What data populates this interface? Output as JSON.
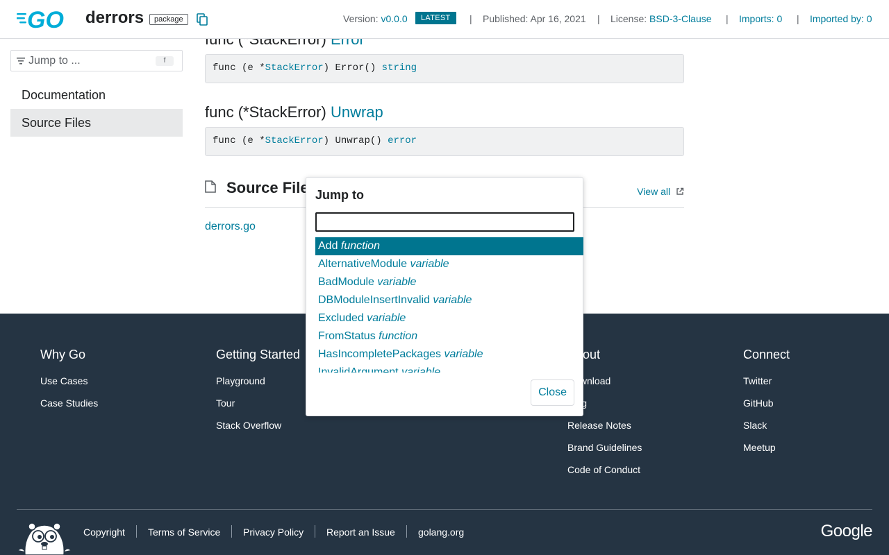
{
  "header": {
    "pkg_name": "derrors",
    "pkg_badge": "package",
    "version_label": "Version:",
    "version": "v0.0.0",
    "latest_badge": "LATEST",
    "published": "Published: Apr 16, 2021",
    "license_label": "License:",
    "license": "BSD-3-Clause",
    "imports": "Imports: 0",
    "imported_by": "Imported by: 0",
    "separator": "|"
  },
  "sidebar": {
    "jump_label": "Jump to ...",
    "jump_key": "f",
    "items": [
      {
        "label": "Documentation"
      },
      {
        "label": "Source Files"
      }
    ]
  },
  "main": {
    "func_error": {
      "prefix": "func (*StackError)",
      "name": "Error"
    },
    "code_error": {
      "p1": "func (e *",
      "type": "StackError",
      "p2": ") Error() ",
      "ret": "string"
    },
    "func_unwrap": {
      "prefix": "func (*StackError)",
      "name": "Unwrap"
    },
    "code_unwrap": {
      "p1": "func (e *",
      "type": "StackError",
      "p2": ") Unwrap() ",
      "ret": "error"
    },
    "source_files_title": "Source Files",
    "view_all": "View all",
    "source_file": "derrors.go"
  },
  "footer": {
    "columns": [
      {
        "title": "Why Go",
        "links": [
          "Use Cases",
          "Case Studies"
        ]
      },
      {
        "title": "Getting Started",
        "links": [
          "Playground",
          "Tour",
          "Stack Overflow"
        ]
      },
      {
        "title": "About",
        "links": [
          "Download",
          "Blog",
          "Release Notes",
          "Brand Guidelines",
          "Code of Conduct"
        ]
      },
      {
        "title": "Connect",
        "links": [
          "Twitter",
          "GitHub",
          "Slack",
          "Meetup"
        ]
      }
    ],
    "legal": [
      "Copyright",
      "Terms of Service",
      "Privacy Policy",
      "Report an Issue",
      "golang.org"
    ],
    "google": "Google"
  },
  "dialog": {
    "title": "Jump to",
    "input_value": "",
    "items": [
      {
        "name": "Add",
        "kind": "function"
      },
      {
        "name": "AlternativeModule",
        "kind": "variable"
      },
      {
        "name": "BadModule",
        "kind": "variable"
      },
      {
        "name": "DBModuleInsertInvalid",
        "kind": "variable"
      },
      {
        "name": "Excluded",
        "kind": "variable"
      },
      {
        "name": "FromStatus",
        "kind": "function"
      },
      {
        "name": "HasIncompletePackages",
        "kind": "variable"
      },
      {
        "name": "InvalidArgument",
        "kind": "variable"
      }
    ],
    "close": "Close"
  },
  "colors": {
    "link": "#007d9c",
    "selected": "#00758f",
    "footer_bg": "#253443"
  }
}
